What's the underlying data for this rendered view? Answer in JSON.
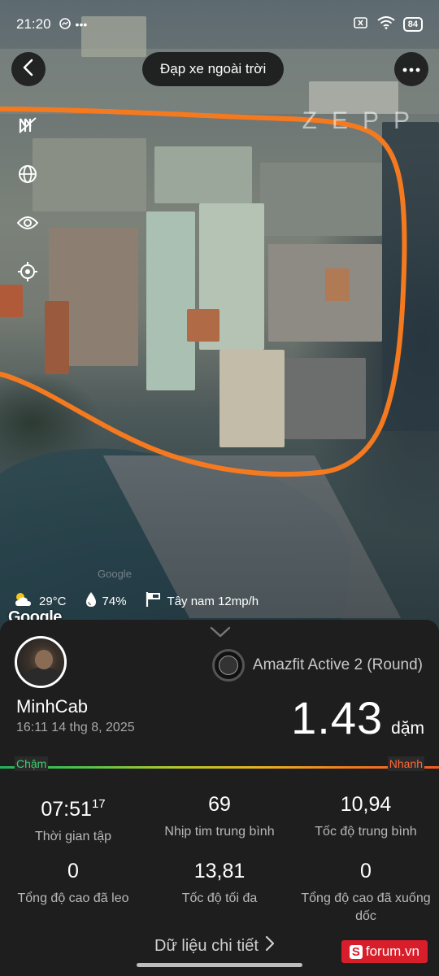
{
  "status_bar": {
    "time": "21:20",
    "battery": "84"
  },
  "header": {
    "title": "Đạp xe ngoài trời",
    "watermark": "ZEPP"
  },
  "map": {
    "attribution": "Google",
    "faint_attribution": "Google",
    "tools": [
      "layers-icon",
      "globe-icon",
      "eye-icon",
      "locate-icon"
    ],
    "route_color": "#f57a1f"
  },
  "weather": {
    "temperature": "29°C",
    "humidity": "74%",
    "wind": "Tây nam 12mp/h"
  },
  "workout": {
    "user_name": "MinhCab",
    "datetime": "16:11 14 thg 8, 2025",
    "device": "Amazfit Active 2 (Round)",
    "distance": "1.43",
    "distance_unit": "dặm",
    "speed_slow_label": "Chậm",
    "speed_fast_label": "Nhanh"
  },
  "stats": [
    {
      "value": "07:51",
      "value_sup": "17",
      "label": "Thời gian tập"
    },
    {
      "value": "69",
      "label": "Nhịp tim trung bình"
    },
    {
      "value": "10,94",
      "label": "Tốc độ trung bình"
    },
    {
      "value": "0",
      "label": "Tổng độ cao đã leo"
    },
    {
      "value": "13,81",
      "label": "Tốc độ tối đa"
    },
    {
      "value": "0",
      "label": "Tổng độ cao đã xuống dốc"
    }
  ],
  "footer": {
    "detail_link": "Dữ liệu chi tiết",
    "badge": "forum.vn",
    "badge_letter": "S"
  },
  "colors": {
    "route": "#f57a1f",
    "sheet_bg": "#1e1e1e",
    "slow": "#3ecf6f",
    "fast": "#ff6a3a",
    "badge": "#d81e2a"
  }
}
